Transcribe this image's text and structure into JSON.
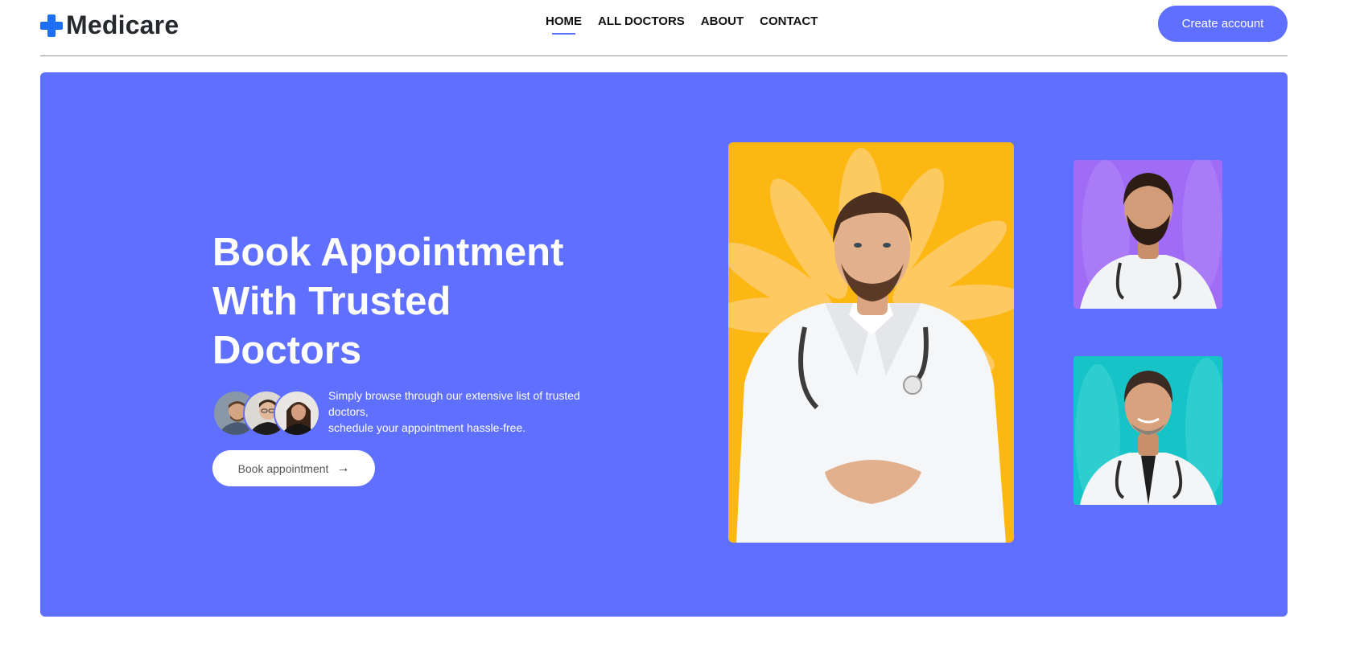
{
  "brand": {
    "name": "Medicare",
    "accent": "#5f6fff",
    "logo_color": "#1e6ff2"
  },
  "nav": {
    "items": [
      {
        "label": "HOME",
        "active": true
      },
      {
        "label": "ALL DOCTORS",
        "active": false
      },
      {
        "label": "ABOUT",
        "active": false
      },
      {
        "label": "CONTACT",
        "active": false
      }
    ],
    "cta_label": "Create account"
  },
  "hero": {
    "title_lines": [
      "Book Appointment",
      "With Trusted",
      "Doctors"
    ],
    "description_lines": [
      "Simply browse through our extensive list of trusted doctors,",
      "schedule your appointment hassle-free."
    ],
    "button_label": "Book appointment",
    "button_icon": "arrow-right-icon",
    "background": "#5f6fff",
    "photos": [
      {
        "name": "doctor-main-photo",
        "background": "#fdb713"
      },
      {
        "name": "doctor-top-photo",
        "background": "#a06cf6"
      },
      {
        "name": "doctor-bottom-photo",
        "background": "#16c4c7"
      }
    ]
  }
}
